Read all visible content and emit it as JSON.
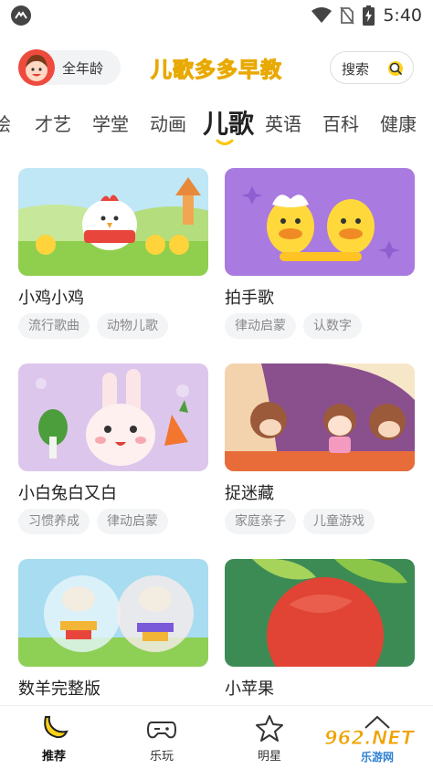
{
  "status": {
    "time": "5:40"
  },
  "header": {
    "age_label": "全年龄",
    "logo_text": "儿歌多多早教",
    "search_label": "搜索"
  },
  "tabs": [
    {
      "label": "绘"
    },
    {
      "label": "才艺"
    },
    {
      "label": "学堂"
    },
    {
      "label": "动画"
    },
    {
      "label": "儿歌"
    },
    {
      "label": "英语"
    },
    {
      "label": "百科"
    },
    {
      "label": "健康"
    }
  ],
  "active_tab": "儿歌",
  "cards": [
    {
      "title": "小鸡小鸡",
      "tags": [
        "流行歌曲",
        "动物儿歌"
      ]
    },
    {
      "title": "拍手歌",
      "tags": [
        "律动启蒙",
        "认数字"
      ]
    },
    {
      "title": "小白兔白又白",
      "tags": [
        "习惯养成",
        "律动启蒙"
      ]
    },
    {
      "title": "捉迷藏",
      "tags": [
        "家庭亲子",
        "儿童游戏"
      ]
    },
    {
      "title": "数羊完整版",
      "tags": []
    },
    {
      "title": "小苹果",
      "tags": []
    }
  ],
  "bottom_nav": [
    {
      "label": "推荐",
      "icon": "banana-icon",
      "active": true
    },
    {
      "label": "乐玩",
      "icon": "gamepad-icon",
      "active": false
    },
    {
      "label": "明星",
      "icon": "star-icon",
      "active": false
    },
    {
      "label": "",
      "icon": "house-icon",
      "active": false
    }
  ],
  "watermark": {
    "text": "962.NET",
    "sub": "乐游网"
  },
  "colors": {
    "accent": "#ffd21a",
    "text": "#222222",
    "tag_bg": "#f3f4f6",
    "tag_text": "#888888"
  }
}
